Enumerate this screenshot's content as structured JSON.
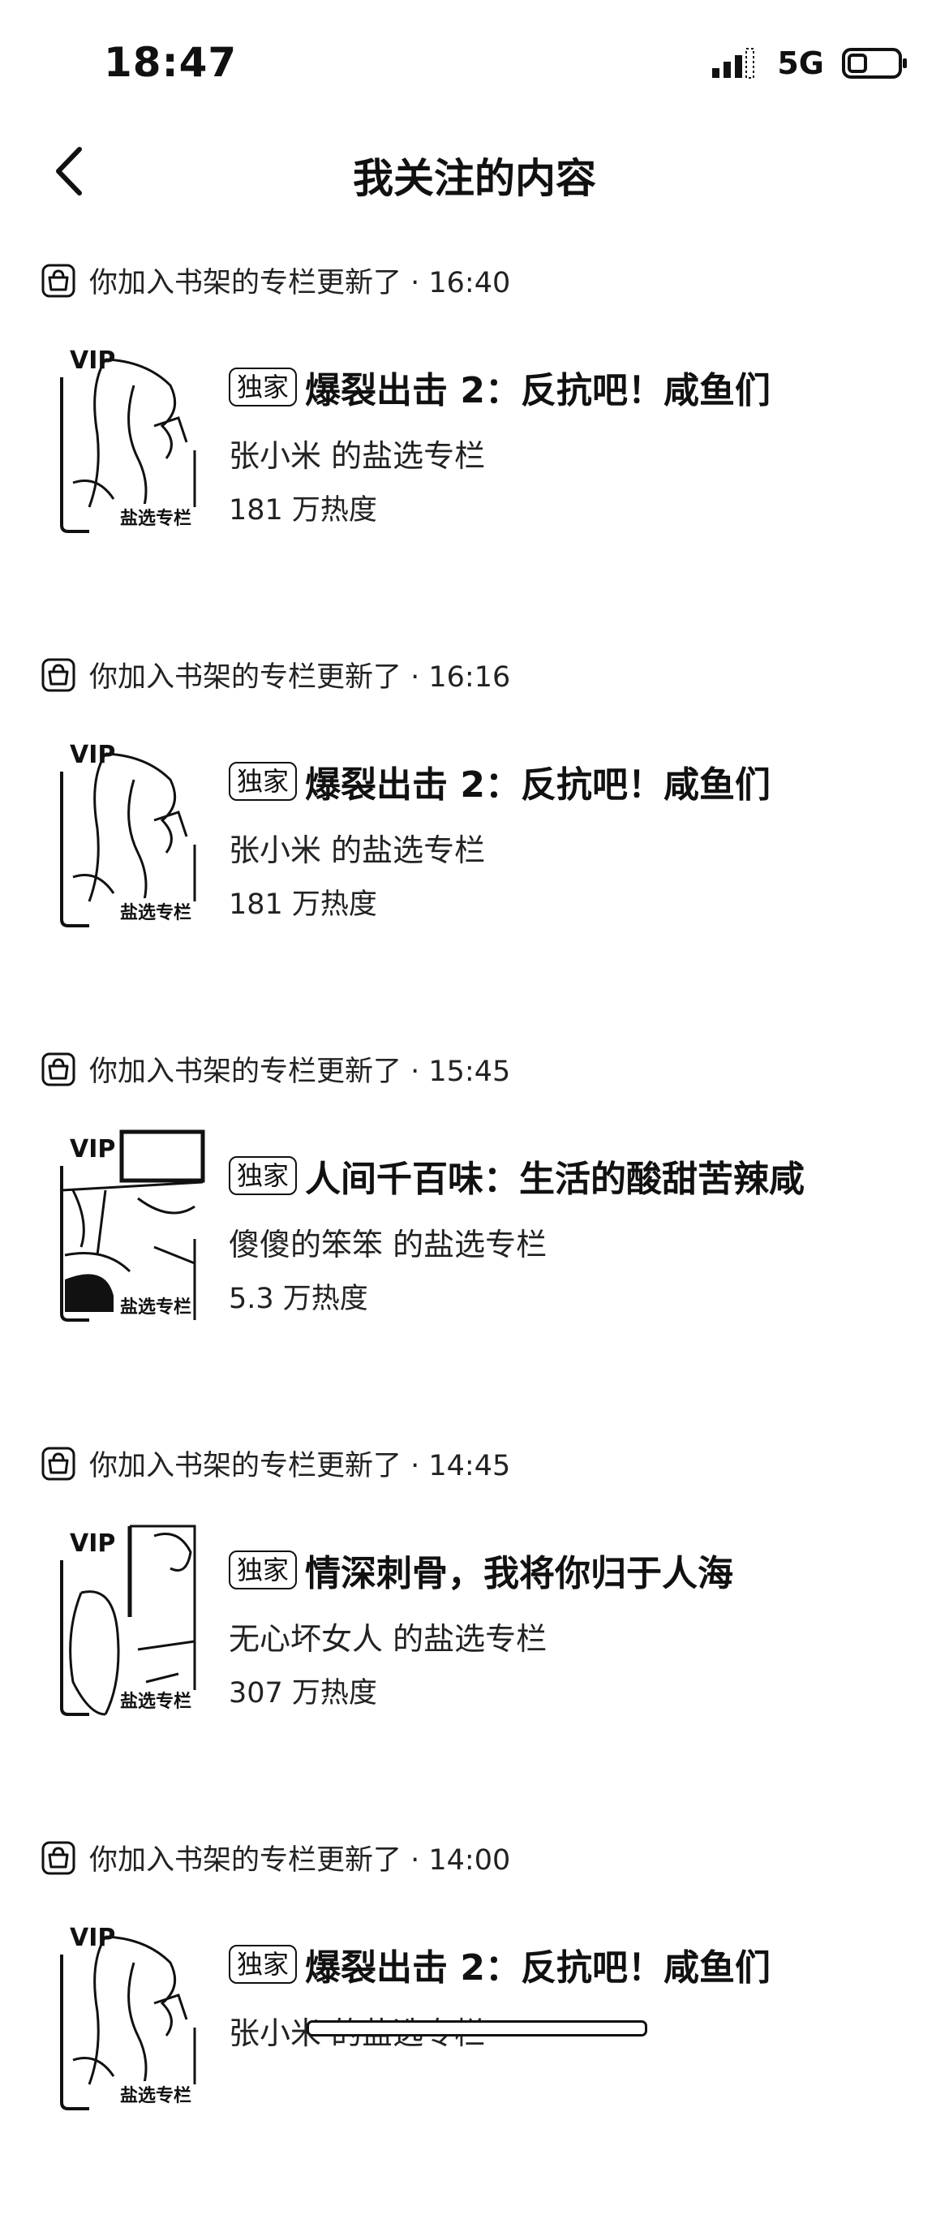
{
  "status_bar": {
    "time": "18:47",
    "network": "5G"
  },
  "nav": {
    "title": "我关注的内容"
  },
  "feed": [
    {
      "header": "你加入书架的专栏更新了 · 16:40",
      "badge": "独家",
      "title": "爆裂出击 2：反抗吧！咸鱼们",
      "author": "张小米 的盐选专栏",
      "heat": "181 万热度",
      "cover": {
        "vip": "VIP",
        "label": "盐选专栏",
        "art": "girl"
      }
    },
    {
      "header": "你加入书架的专栏更新了 · 16:16",
      "badge": "独家",
      "title": "爆裂出击 2：反抗吧！咸鱼们",
      "author": "张小米 的盐选专栏",
      "heat": "181 万热度",
      "cover": {
        "vip": "VIP",
        "label": "盐选专栏",
        "art": "girl"
      }
    },
    {
      "header": "你加入书架的专栏更新了 · 15:45",
      "badge": "独家",
      "title": "人间千百味：生活的酸甜苦辣咸",
      "author": "傻傻的笨笨 的盐选专栏",
      "heat": "5.3 万热度",
      "cover": {
        "vip": "VIP",
        "label": "盐选专栏",
        "art": "room"
      }
    },
    {
      "header": "你加入书架的专栏更新了 · 14:45",
      "badge": "独家",
      "title": "情深刺骨，我将你归于人海",
      "author": "无心坏女人 的盐选专栏",
      "heat": "307 万热度",
      "cover": {
        "vip": "VIP",
        "label": "盐选专栏",
        "art": "couple"
      }
    },
    {
      "header": "你加入书架的专栏更新了 · 14:00",
      "badge": "独家",
      "title": "爆裂出击 2：反抗吧！咸鱼们",
      "author": "张小米 的盐选专栏",
      "heat": "",
      "cover": {
        "vip": "VIP",
        "label": "盐选专栏",
        "art": "girl"
      }
    }
  ]
}
